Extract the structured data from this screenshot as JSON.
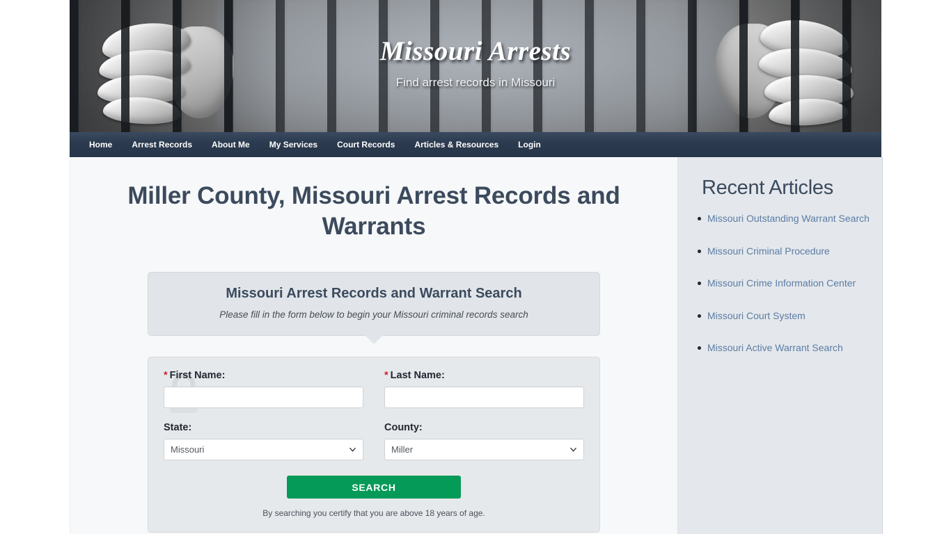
{
  "site": {
    "title": "Missouri Arrests",
    "tagline": "Find arrest records in Missouri"
  },
  "nav": {
    "items": [
      {
        "label": "Home",
        "name": "nav-home"
      },
      {
        "label": "Arrest Records",
        "name": "nav-arrest-records"
      },
      {
        "label": "About Me",
        "name": "nav-about-me"
      },
      {
        "label": "My Services",
        "name": "nav-my-services"
      },
      {
        "label": "Court Records",
        "name": "nav-court-records"
      },
      {
        "label": "Articles & Resources",
        "name": "nav-articles-resources"
      },
      {
        "label": "Login",
        "name": "nav-login"
      }
    ]
  },
  "main": {
    "page_title": "Miller County, Missouri Arrest Records and Warrants",
    "callout": {
      "title": "Missouri Arrest Records and Warrant Search",
      "subtitle": "Please fill in the form below to begin your Missouri criminal records search"
    },
    "form": {
      "first_name_label": "First Name:",
      "last_name_label": "Last Name:",
      "state_label": "State:",
      "county_label": "County:",
      "required_marker": "*",
      "first_name_value": "",
      "last_name_value": "",
      "first_name_placeholder": "",
      "last_name_placeholder": "",
      "state_value": "Missouri",
      "county_value": "Miller",
      "state_options": [
        "Missouri"
      ],
      "county_options": [
        "Miller"
      ],
      "search_button": "SEARCH",
      "disclaimer": "By searching you certify that you are above 18 years of age."
    }
  },
  "sidebar": {
    "title": "Recent Articles",
    "articles": [
      {
        "label": "Missouri Outstanding Warrant Search"
      },
      {
        "label": "Missouri Criminal Procedure"
      },
      {
        "label": "Missouri Crime Information Center"
      },
      {
        "label": "Missouri Court System"
      },
      {
        "label": "Missouri Active Warrant Search"
      }
    ]
  },
  "colors": {
    "nav_bar": "#2b3a4e",
    "heading": "#3c4a5d",
    "link": "#5b7ba3",
    "search_button": "#069a58",
    "required_star": "#cf2233",
    "sidebar_bg": "#e4e8ec",
    "main_bg": "#f7f8f9"
  }
}
